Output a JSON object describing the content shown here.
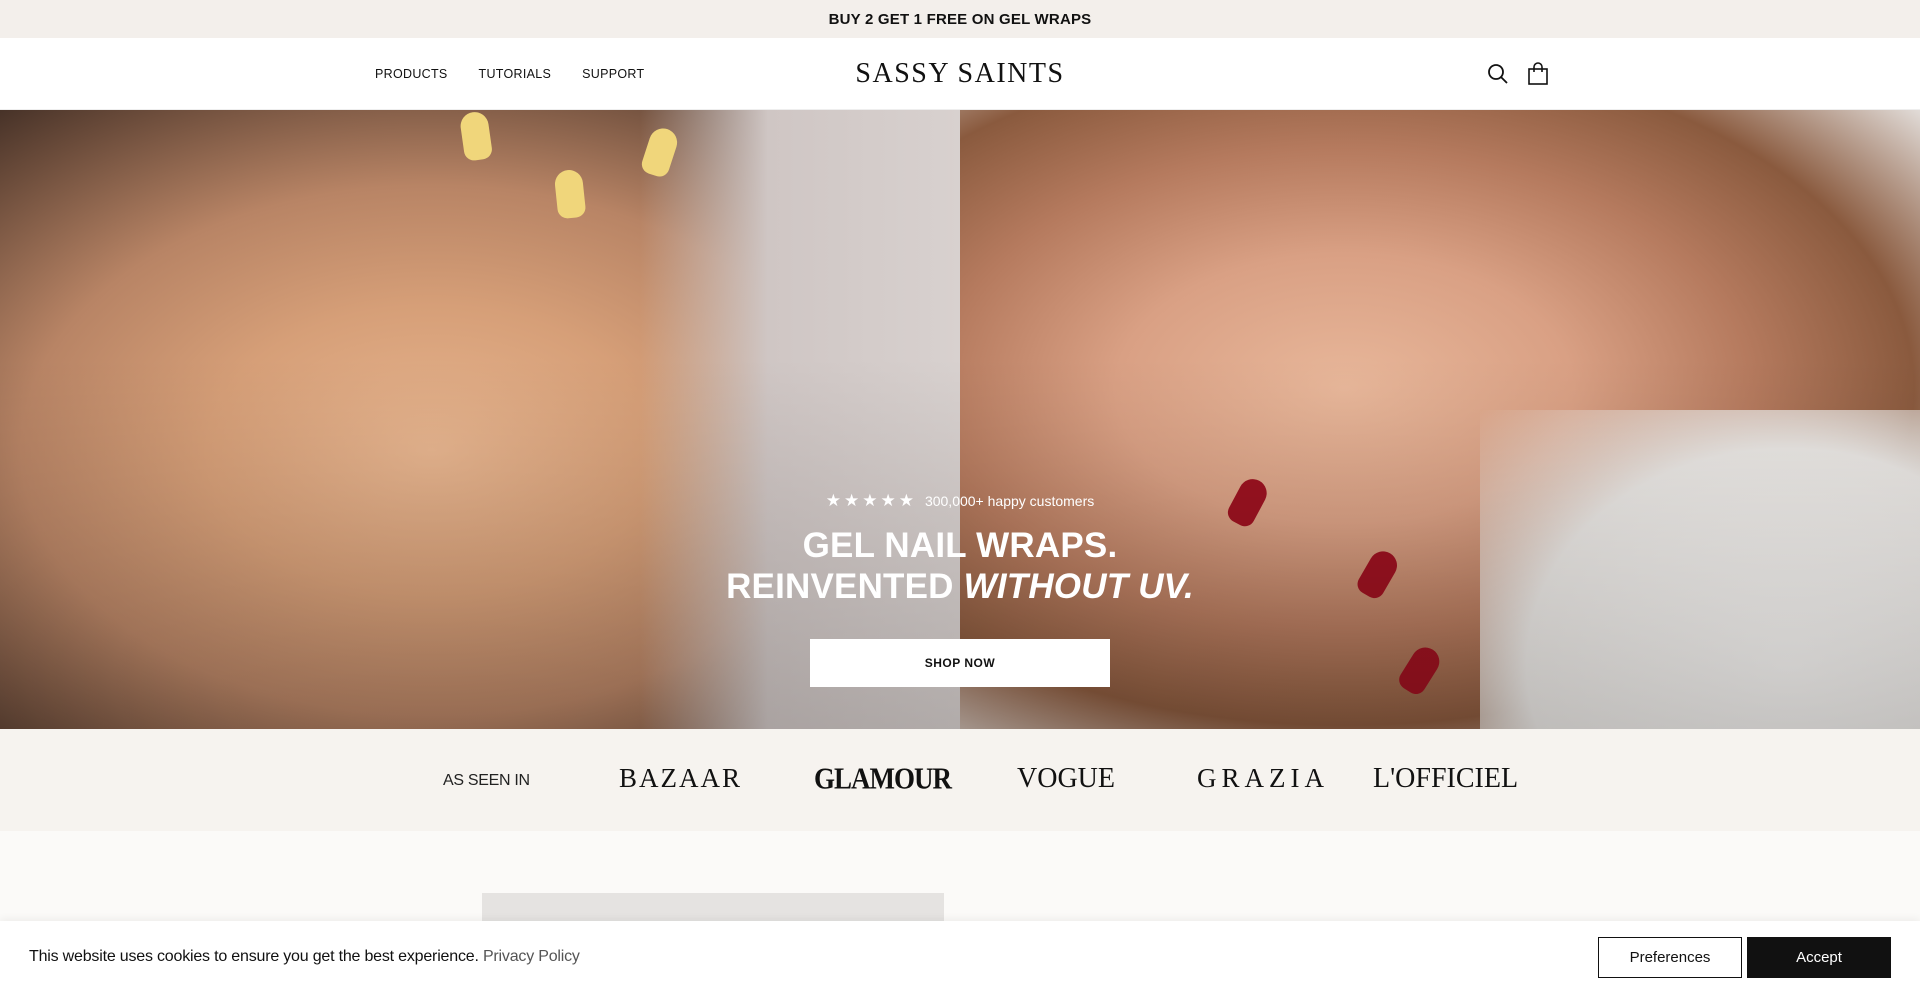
{
  "promo": {
    "text": "BUY 2 GET 1 FREE ON GEL WRAPS"
  },
  "header": {
    "nav": [
      {
        "label": "PRODUCTS"
      },
      {
        "label": "TUTORIALS"
      },
      {
        "label": "SUPPORT"
      }
    ],
    "logo": "SASSY SAINTS",
    "icons": [
      "search-icon",
      "bag-icon"
    ]
  },
  "hero": {
    "stars": "★★★★★",
    "rating_text": "300,000+ happy customers",
    "headline_line1": "GEL NAIL WRAPS.",
    "headline_line2_prefix": "REINVENTED ",
    "headline_line2_italic": "WITHOUT UV.",
    "cta": "SHOP NOW"
  },
  "press": {
    "label": "AS SEEN IN",
    "logos": [
      "BAZAAR",
      "GLAMOUR",
      "VOGUE",
      "GRAZIA",
      "L'OFFICIEL"
    ]
  },
  "cookie": {
    "message": "This website uses cookies to ensure you get the best experience.",
    "link": "Privacy Policy",
    "preferences": "Preferences",
    "accept": "Accept"
  },
  "colors": {
    "promo_bg": "#f3efeb",
    "press_bg": "#f6f3ef",
    "red_nail": "#9b1220",
    "yellow_nail": "#f0d67b"
  }
}
